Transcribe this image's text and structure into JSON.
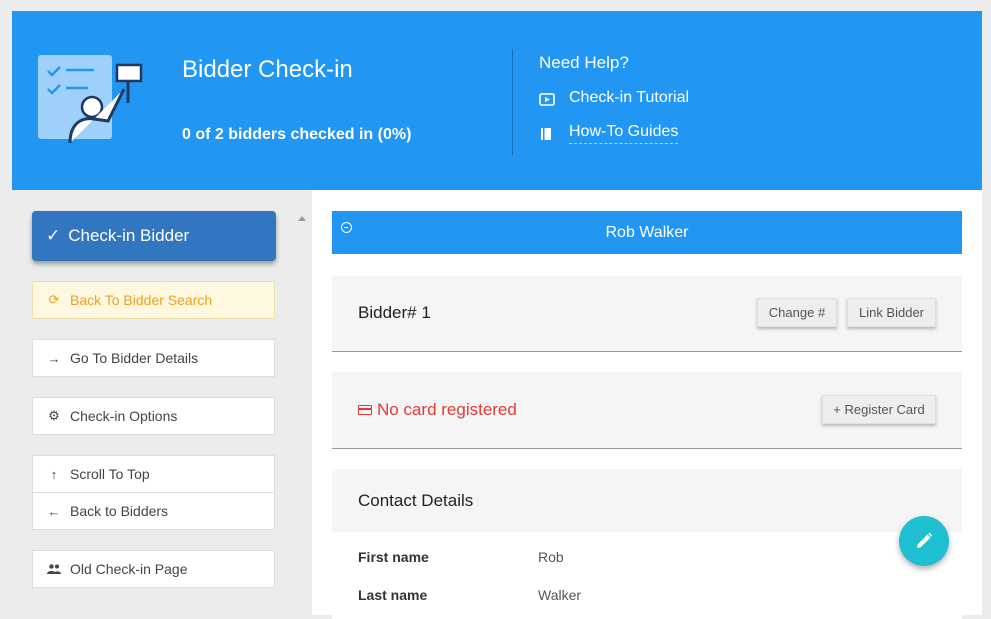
{
  "header": {
    "title": "Bidder Check-in",
    "progress": "0 of 2 bidders checked in (0%)",
    "help": {
      "title": "Need Help?",
      "links": [
        {
          "label": "Check-in Tutorial",
          "icon": "video-icon"
        },
        {
          "label": "How-To Guides",
          "icon": "book-icon"
        }
      ]
    },
    "bg_color": "#2196f3"
  },
  "sidebar": {
    "checkin_label": "Check-in Bidder",
    "items": [
      {
        "label": "Back To Bidder Search",
        "icon": "refresh-icon"
      },
      {
        "label": "Go To Bidder Details",
        "icon": "arrow-right-icon"
      },
      {
        "label": "Check-in Options",
        "icon": "gear-icon"
      },
      {
        "label": "Scroll To Top",
        "icon": "arrow-up-icon"
      },
      {
        "label": "Back to Bidders",
        "icon": "arrow-left-icon"
      },
      {
        "label": "Old Check-in Page",
        "icon": "people-icon"
      }
    ]
  },
  "main": {
    "bidder_name": "Rob Walker",
    "bidder_number_label": "Bidder# 1",
    "change_label": "Change #",
    "link_label": "Link Bidder",
    "card_status": "No card registered",
    "register_label": "+ Register Card",
    "contact": {
      "title": "Contact Details",
      "rows": [
        {
          "label": "First name",
          "value": "Rob"
        },
        {
          "label": "Last name",
          "value": "Walker"
        }
      ]
    }
  },
  "colors": {
    "accent": "#2196f3",
    "primary_button": "#3276c0",
    "warning": "#f0a020",
    "error": "#e53935",
    "fab": "#1ebfd0"
  }
}
